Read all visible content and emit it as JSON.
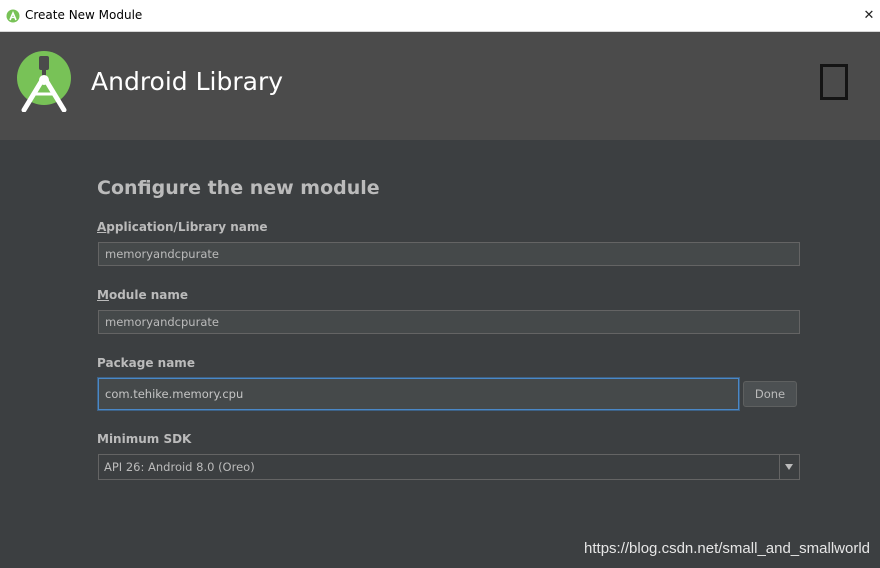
{
  "window": {
    "title": "Create New Module",
    "close_glyph": "✕",
    "app_icon": "android-studio-icon"
  },
  "header": {
    "title": "Android Library",
    "logo_icon": "android-studio-logo-icon",
    "form_factor_icon": "phone-tablet-icon"
  },
  "form": {
    "heading": "Configure the new module",
    "app_name": {
      "label_mnemonic": "A",
      "label_rest": "pplication/Library name",
      "value": "memoryandcpurate"
    },
    "module_name": {
      "label_mnemonic": "M",
      "label_rest": "odule name",
      "value": "memoryandcpurate"
    },
    "package_name": {
      "label": "Package name",
      "value": "com.tehike.memory.cpu",
      "done_label": "Done"
    },
    "min_sdk": {
      "label": "Minimum SDK",
      "selected": "API 26: Android 8.0 (Oreo)"
    }
  },
  "watermark": "https://blog.csdn.net/small_and_smallworld",
  "colors": {
    "body": "#3c3f41",
    "header": "#4b4b4b",
    "android_green": "#78c257",
    "focus_border": "#4a88c7",
    "label_text": "#bbbbbb"
  }
}
